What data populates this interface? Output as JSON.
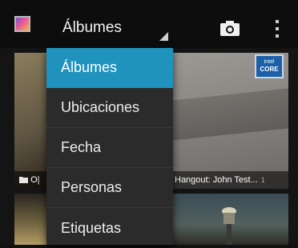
{
  "action_bar": {
    "title": "Álbumes",
    "app_icon": "gallery-app-icon",
    "camera_icon": "camera-icon",
    "overflow_icon": "overflow-menu-icon"
  },
  "menu": {
    "selected_color": "#1f93bd",
    "items": [
      {
        "label": "Álbumes",
        "selected": true
      },
      {
        "label": "Ubicaciones",
        "selected": false
      },
      {
        "label": "Fecha",
        "selected": false
      },
      {
        "label": "Personas",
        "selected": false
      },
      {
        "label": "Etiquetas",
        "selected": false
      }
    ]
  },
  "albums": [
    {
      "caption": "O|",
      "icon": "folder-icon"
    },
    {
      "caption": "Hangout: John Test...",
      "count": "1"
    }
  ],
  "intel_badge": {
    "line1": "intel",
    "line2": "CORE"
  }
}
